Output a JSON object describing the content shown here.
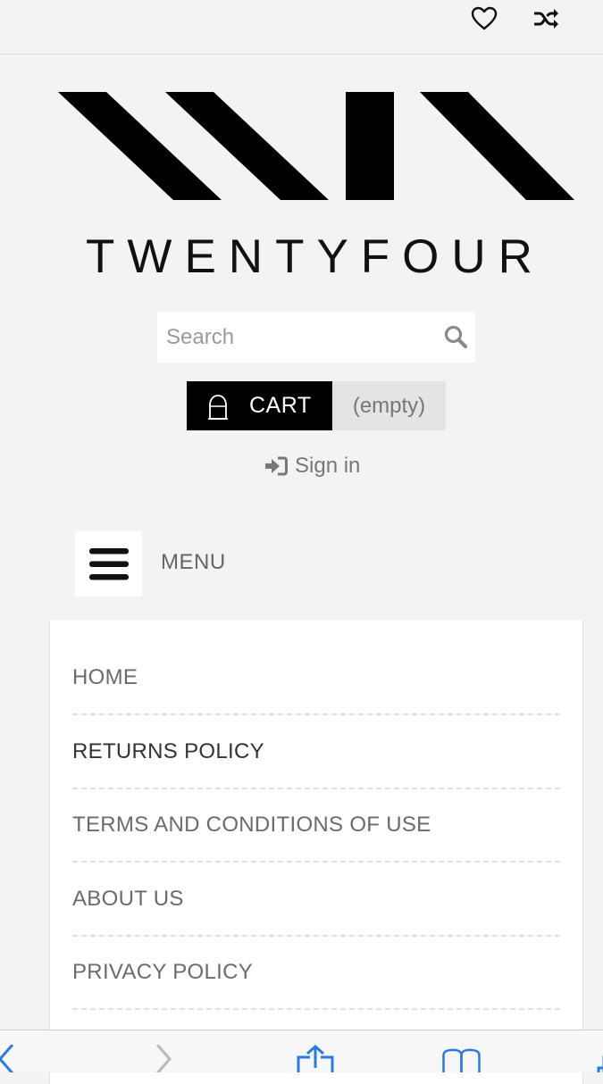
{
  "header": {
    "wishlist_icon": "heart-icon",
    "compare_icon": "shuffle-icon"
  },
  "logo": {
    "brand_name": "TWENTYFOUR"
  },
  "search": {
    "placeholder": "Search",
    "button_icon": "search-icon"
  },
  "cart": {
    "label": "CART",
    "status": "(empty)",
    "icon": "shopping-bag-icon"
  },
  "account": {
    "signin_label": "Sign in",
    "icon": "sign-in-icon"
  },
  "menu": {
    "toggle_label": "MENU",
    "toggle_icon": "hamburger-icon",
    "items": [
      {
        "label": "HOME"
      },
      {
        "label": "RETURNS POLICY"
      },
      {
        "label": "TERMS AND CONDITIONS OF USE"
      },
      {
        "label": "ABOUT US"
      },
      {
        "label": "PRIVACY POLICY"
      }
    ]
  },
  "browser_toolbar": {
    "icons": [
      "back-icon",
      "forward-icon",
      "share-icon",
      "bookmarks-icon",
      "tabs-icon"
    ],
    "accent_color": "#2a7ae2"
  },
  "colors": {
    "background": "#f4f3f4",
    "cart_background": "#000000",
    "cart_status_background": "#e4e4e4"
  }
}
